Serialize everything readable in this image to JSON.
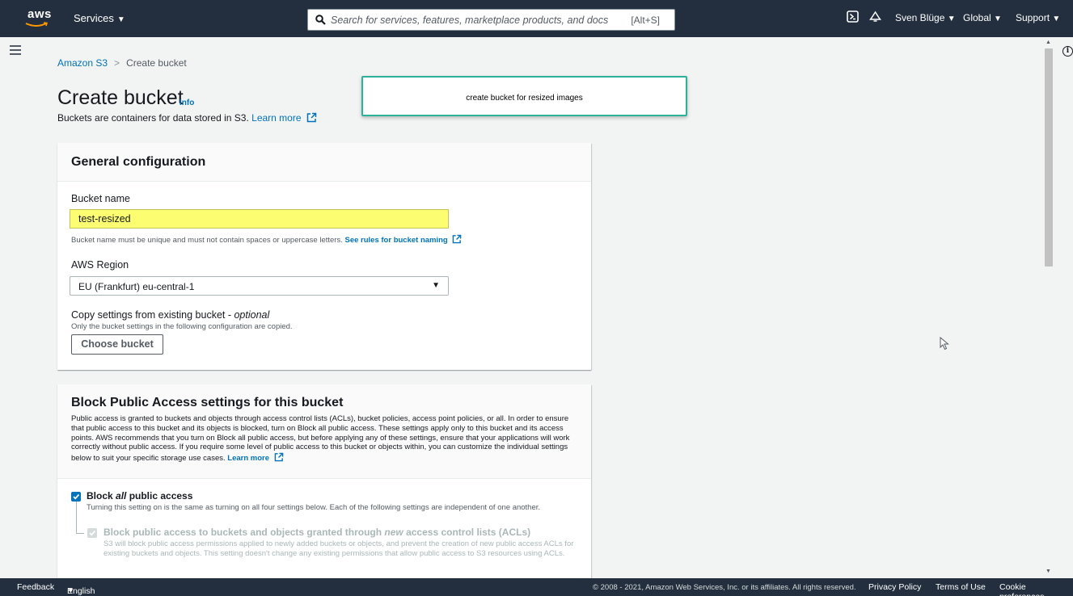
{
  "topnav": {
    "logo": "aws",
    "services_label": "Services",
    "search_placeholder": "Search for services, features, marketplace products, and docs",
    "search_shortcut": "[Alt+S]",
    "user": "Sven Blüge",
    "region": "Global",
    "support": "Support",
    "caret": "▼"
  },
  "breadcrumb": {
    "root": "Amazon S3",
    "separator": ">",
    "current": "Create bucket"
  },
  "header": {
    "title": "Create bucket",
    "info": "Info",
    "description": "Buckets are containers for data stored in S3.",
    "learn_more": "Learn more"
  },
  "annotation": {
    "text": "create bucket for resized images"
  },
  "general": {
    "title": "General configuration",
    "bucket_name_label": "Bucket name",
    "bucket_name_value": "test-resized",
    "bucket_name_hint": "Bucket name must be unique and must not contain spaces or uppercase letters.",
    "bucket_name_rules_link": "See rules for bucket naming",
    "region_label": "AWS Region",
    "region_value": "EU (Frankfurt) eu-central-1",
    "copy_label": "Copy settings from existing bucket - ",
    "copy_optional": "optional",
    "copy_hint": "Only the bucket settings in the following configuration are copied.",
    "choose_button": "Choose bucket"
  },
  "block_public": {
    "title": "Block Public Access settings for this bucket",
    "description": "Public access is granted to buckets and objects through access control lists (ACLs), bucket policies, access point policies, or all. In order to ensure that public access to this bucket and its objects is blocked, turn on Block all public access. These settings apply only to this bucket and its access points. AWS recommends that you turn on Block all public access, but before applying any of these settings, ensure that your applications will work correctly without public access. If you require some level of public access to this bucket or objects within, you can customize the individual settings below to suit your specific storage use cases.",
    "learn_more": "Learn more",
    "block_all_pre": "Block ",
    "block_all_em": "all",
    "block_all_post": " public access",
    "block_all_checked": true,
    "block_all_desc": "Turning this setting on is the same as turning on all four settings below. Each of the following settings are independent of one another.",
    "acl_new_pre": "Block public access to buckets and objects granted through ",
    "acl_new_em": "new",
    "acl_new_post": " access control lists (ACLs)",
    "acl_new_desc": "S3 will block public access permissions applied to newly added buckets or objects, and prevent the creation of new public access ACLs for existing buckets and objects. This setting doesn't change any existing permissions that allow public access to S3 resources using ACLs."
  },
  "footer": {
    "feedback": "Feedback",
    "language": "English (US)",
    "copyright": "© 2008 - 2021, Amazon Web Services, Inc. or its affiliates. All rights reserved.",
    "privacy": "Privacy Policy",
    "terms": "Terms of Use",
    "cookies": "Cookie preferences"
  },
  "colors": {
    "nav_bg": "#232f3e",
    "link": "#0073bb",
    "highlight": "#fdfd72",
    "annotation_border": "#2bb29a"
  }
}
